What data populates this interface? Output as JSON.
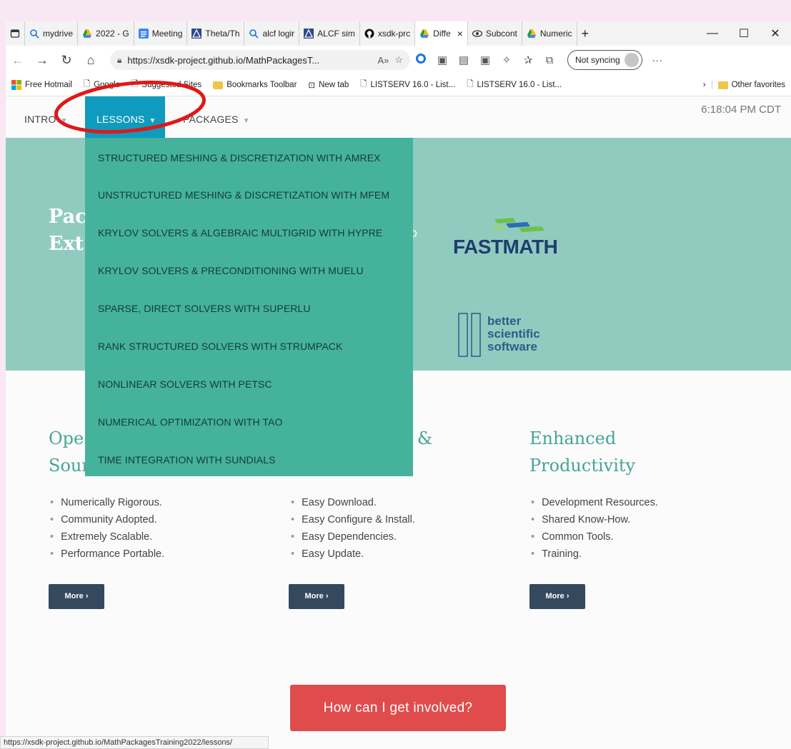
{
  "browser": {
    "tabs": [
      {
        "label": "",
        "icon": "tab-actions-icon"
      },
      {
        "label": "mydrive",
        "icon": "search-icon"
      },
      {
        "label": "2022 - G",
        "icon": "drive-icon"
      },
      {
        "label": "Meeting",
        "icon": "docs-icon"
      },
      {
        "label": "Theta/Th",
        "icon": "alcf-icon"
      },
      {
        "label": "alcf logir",
        "icon": "search-icon"
      },
      {
        "label": "ALCF sim",
        "icon": "alcf-icon"
      },
      {
        "label": "xsdk-prc",
        "icon": "github-icon"
      },
      {
        "label": "Diffe",
        "icon": "drive-icon",
        "active": true
      },
      {
        "label": "Subcont",
        "icon": "eye-icon"
      },
      {
        "label": "Numeric",
        "icon": "drive-icon"
      }
    ],
    "close_glyph": "×",
    "newtab_glyph": "+",
    "window": {
      "min": "—",
      "max": "☐",
      "close": "✕"
    },
    "url": "https://xsdk-project.github.io/MathPackagesT...",
    "sync_label": "Not syncing",
    "more_glyph": "···",
    "bookmarks": [
      "Free Hotmail",
      "Google",
      "Suggested Sites",
      "Bookmarks Toolbar",
      "New tab",
      "LISTSERV 16.0 - List...",
      "LISTSERV 16.0 - List..."
    ],
    "other_favorites": "Other favorites",
    "status_url": "https://xsdk-project.github.io/MathPackagesTraining2022/lessons/"
  },
  "site": {
    "nav": {
      "intro": "INTRO",
      "lessons": "LESSONS",
      "packages": "PACKAGES",
      "caret": "▼"
    },
    "clock": "6:18:04 PM CDT",
    "hero": {
      "title_line1": "Pac",
      "title_line2": "Ext",
      "tail": "D"
    },
    "logos": {
      "fastmath": "FASTMATH",
      "bssw_1": "better",
      "bssw_2": "scientific",
      "bssw_3": "software"
    },
    "lessons_menu": [
      "STRUCTURED MESHING & DISCRETIZATION WITH AMREX",
      "UNSTRUCTURED MESHING & DISCRETIZATION WITH MFEM",
      "KRYLOV SOLVERS & ALGEBRAIC MULTIGRID WITH HYPRE",
      "KRYLOV SOLVERS & PRECONDITIONING WITH MUELU",
      "SPARSE, DIRECT SOLVERS WITH SUPERLU",
      "RANK STRUCTURED SOLVERS WITH STRUMPACK",
      "NONLINEAR SOLVERS WITH PETSC",
      "NUMERICAL OPTIMIZATION WITH TAO",
      "TIME INTEGRATION WITH SUNDIALS"
    ],
    "columns": [
      {
        "head1": "Ope",
        "head2": "Sour",
        "items": [
          "Numerically Rigorous.",
          "Community Adopted.",
          "Extremely Scalable.",
          "Performance Portable."
        ],
        "more": "More ›"
      },
      {
        "head1": "ty &",
        "head2": "",
        "items": [
          "Easy Download.",
          "Easy Configure & Install.",
          "Easy Dependencies.",
          "Easy Update."
        ],
        "more": "More ›"
      },
      {
        "head1": "Enhanced",
        "head2": "Productivity",
        "items": [
          "Development Resources.",
          "Shared Know-How.",
          "Common Tools.",
          "Training."
        ],
        "more": "More ›"
      }
    ],
    "cta": "How can I get involved?"
  },
  "colors": {
    "accent_teal": "#45b29c",
    "nav_active": "#0e9bbd",
    "hero": "#91cbc0",
    "cta_red": "#e04c4c",
    "annotation_red": "#e01818"
  }
}
